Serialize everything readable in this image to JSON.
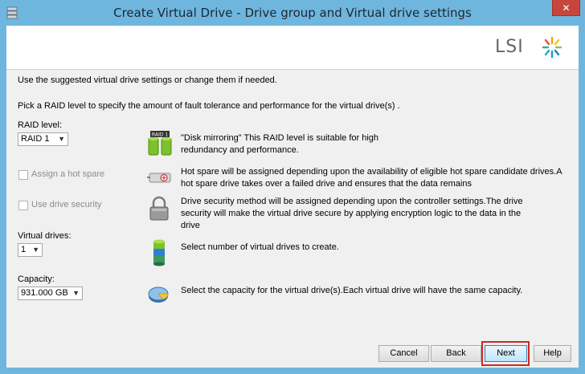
{
  "window": {
    "title": "Create Virtual Drive - Drive group and Virtual drive settings",
    "close_label": "✕"
  },
  "logo": {
    "text": "LSI"
  },
  "intro": {
    "line1": "Use the suggested virtual drive settings or change them if needed.",
    "line2": "Pick a RAID level to specify the amount of fault tolerance and performance for the virtual drive(s) ."
  },
  "raid": {
    "label": "RAID level:",
    "selected": "RAID  1",
    "icon_badge": "RAID 1",
    "description": "\"Disk mirroring\" This RAID level is suitable for high redundancy and performance."
  },
  "hot_spare": {
    "label": "Assign a hot spare",
    "checked": false,
    "enabled": false,
    "description": "Hot spare will be assigned depending upon the availability of eligible hot spare candidate drives.A hot spare drive takes over a failed drive and ensures that the data remains"
  },
  "drive_security": {
    "label": "Use drive security",
    "checked": false,
    "enabled": false,
    "description": "Drive security method will be assigned depending upon the controller settings.The drive security will make the virtual drive secure by applying encryption logic to the data in the drive"
  },
  "virtual_drives": {
    "label": "Virtual drives:",
    "selected": "1",
    "description": "Select number of virtual drives to create."
  },
  "capacity": {
    "label": "Capacity:",
    "selected": "931.000 GB",
    "description": "Select the capacity for the virtual drive(s).Each virtual drive will have the same capacity."
  },
  "buttons": {
    "cancel": "Cancel",
    "back": "Back",
    "next": "Next",
    "help": "Help"
  },
  "icons": {
    "app": "raid-app-icon",
    "raid": "raid-disks-icon",
    "hot_spare": "hot-spare-drive-icon",
    "security": "padlock-icon",
    "virtual_drives": "database-stack-icon",
    "capacity": "capacity-pie-icon"
  },
  "colors": {
    "title_bar": "#6fb6de",
    "close_button": "#c7463b",
    "highlight": "#d0261f"
  }
}
